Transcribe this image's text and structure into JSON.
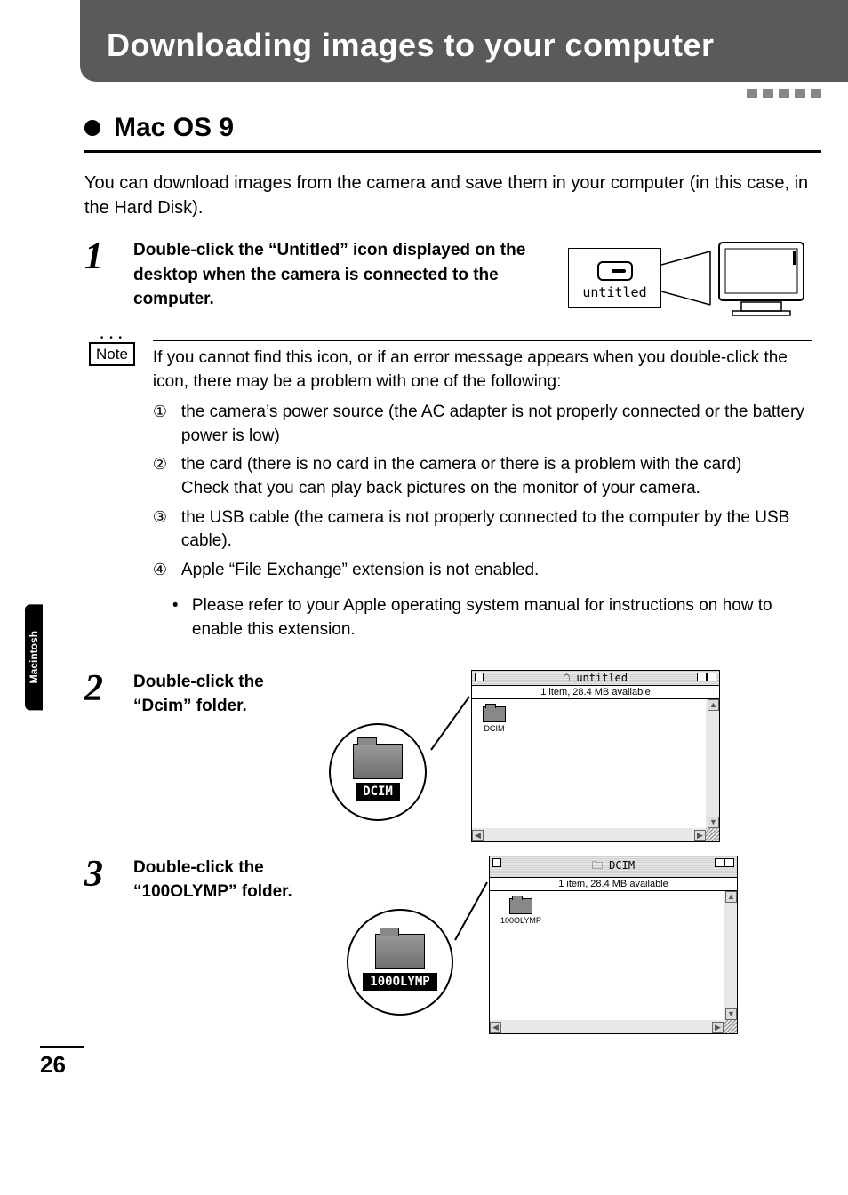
{
  "header": {
    "title": "Downloading images to your computer"
  },
  "section": {
    "heading": "Mac OS 9"
  },
  "intro": "You can download images from the camera and save them in your computer (in this case, in the Hard Disk).",
  "sideTab": "Macintosh",
  "pageNumber": "26",
  "steps": {
    "s1": {
      "num": "1",
      "text": "Double-click the “Untitled” icon displayed on the desktop when the camera is connected to the computer.",
      "iconLabel": "untitled"
    },
    "s2": {
      "num": "2",
      "text": "Double-click the “Dcim” folder.",
      "calloutLabel": "DCIM",
      "winTitle": "untitled",
      "winStatus": "1 item, 28.4 MB available",
      "winItem": "DCIM"
    },
    "s3": {
      "num": "3",
      "text": "Double-click the “100OLYMP” folder.",
      "calloutLabel": "100OLYMP",
      "winTitle": "DCIM",
      "winStatus": "1 item, 28.4 MB available",
      "winItem": "100OLYMP"
    }
  },
  "note": {
    "label": "Note",
    "lead": "If you cannot find this icon, or if an error message appears when you double-click the icon, there may be a problem with one of the following:",
    "items": {
      "i1": {
        "mark": "①",
        "text": "the camera’s power source (the AC adapter is not properly connected or the battery power is low)"
      },
      "i2": {
        "mark": "②",
        "text": "the card (there is no card in the camera or there is a problem with the card)",
        "text2": "Check that you can play back pictures on the monitor of your camera."
      },
      "i3": {
        "mark": "③",
        "text": "the USB cable (the camera is not properly connected to the computer by the USB cable)."
      },
      "i4": {
        "mark": "④",
        "text": "Apple “File Exchange” extension is not enabled.",
        "sub": "Please refer to your Apple operating system manual for instructions on how to enable this extension."
      }
    }
  }
}
